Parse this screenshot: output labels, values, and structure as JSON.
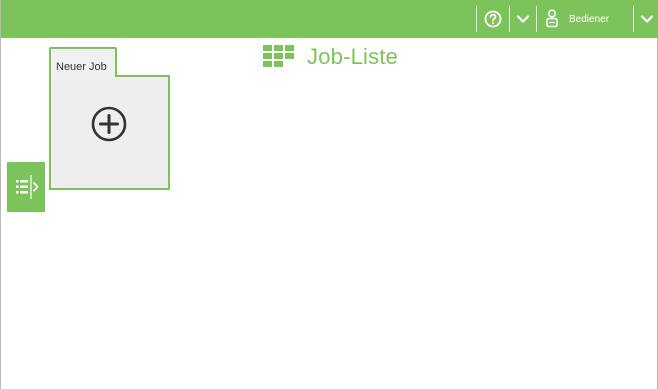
{
  "header": {
    "user_label": "Bediener"
  },
  "page": {
    "title": "Job-Liste"
  },
  "jobs": {
    "new_job_label": "Neuer Job"
  },
  "icons": {
    "help": "help-circle-icon",
    "chevron": "chevron-down-icon",
    "user": "user-badge-icon",
    "grid": "grid-icon",
    "add": "add-circle-icon",
    "list": "list-icon"
  },
  "colors": {
    "accent": "#7dc35b",
    "tile_bg": "#eeeeee",
    "icon_dark": "#333333"
  }
}
